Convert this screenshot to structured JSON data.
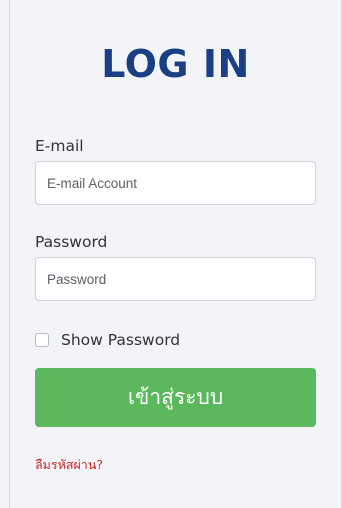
{
  "login": {
    "title": "LOG IN",
    "email_label": "E-mail",
    "email_placeholder": "E-mail Account",
    "email_value": "",
    "password_label": "Password",
    "password_placeholder": "Password",
    "password_value": "",
    "show_password_label": "Show Password",
    "show_password_checked": false,
    "submit_label": "เข้าสู่ระบบ",
    "forgot_label": "ลืมรหัสผ่าน?"
  },
  "colors": {
    "title": "#1a3f85",
    "button": "#5cb85c",
    "forgot_link": "#c62828",
    "background": "#f3f4f8"
  }
}
